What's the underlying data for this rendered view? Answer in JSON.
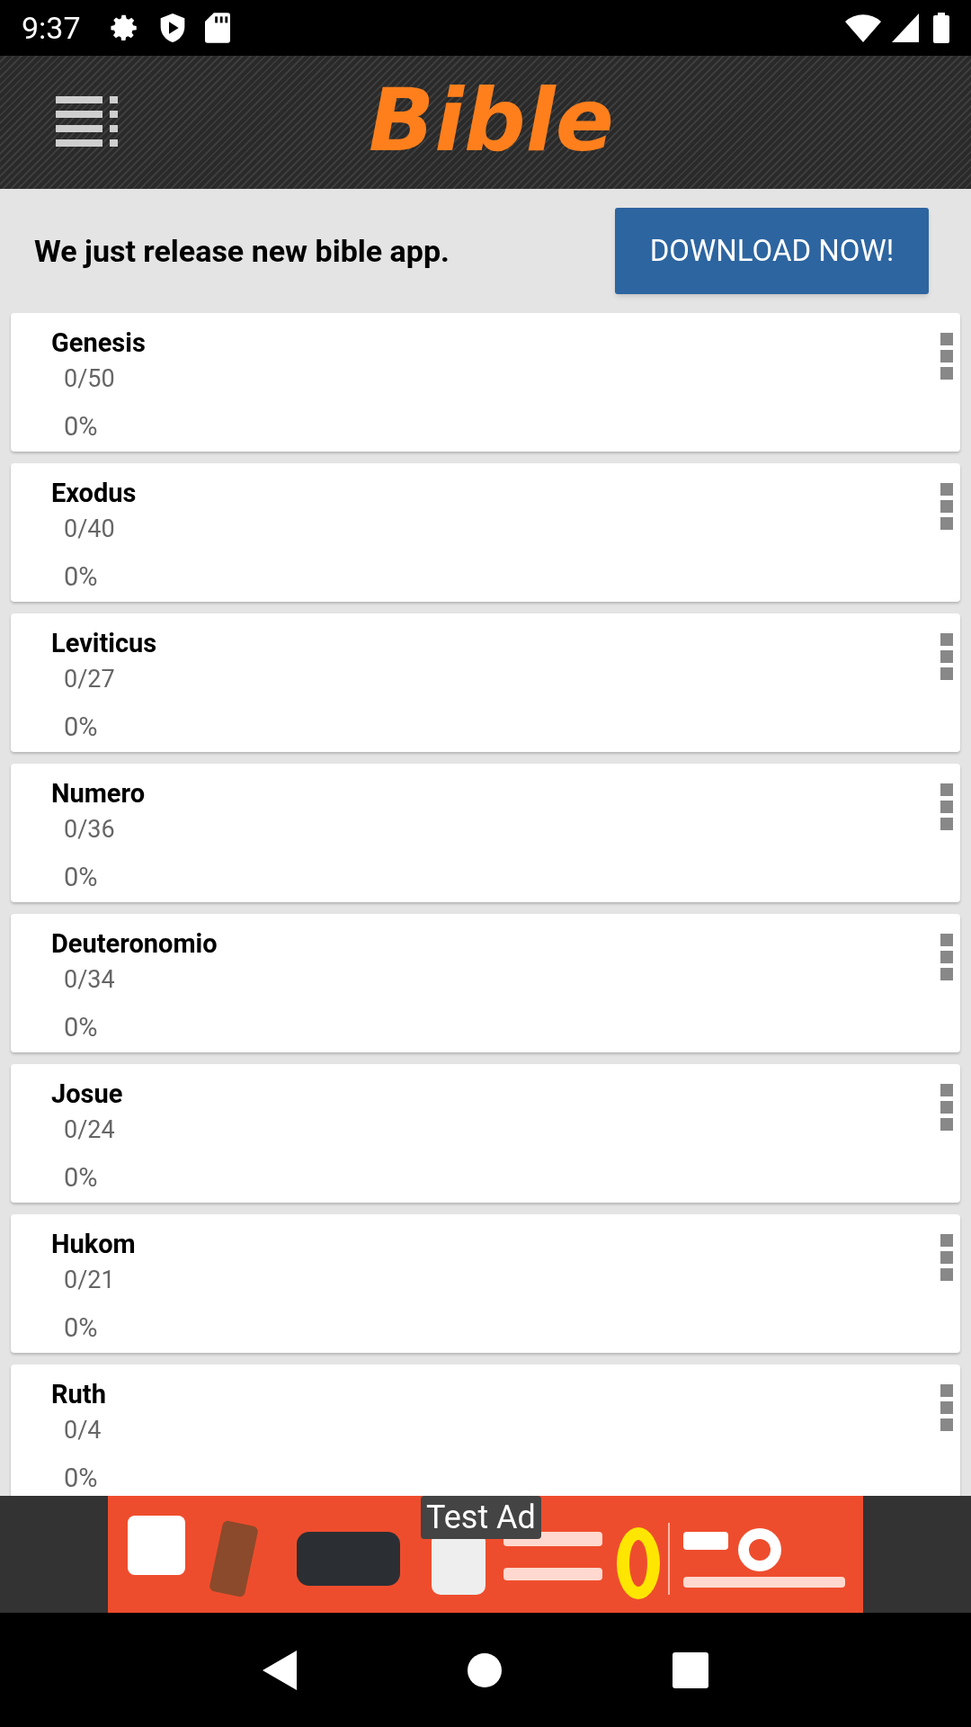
{
  "status_bar": {
    "time": "9:37"
  },
  "header": {
    "title": "Bible"
  },
  "promo": {
    "message": "We just release new bible app.",
    "button": "DOWNLOAD NOW!"
  },
  "books": [
    {
      "name": "Genesis",
      "chapters": "0/50",
      "percent": "0%"
    },
    {
      "name": "Exodus",
      "chapters": "0/40",
      "percent": "0%"
    },
    {
      "name": "Leviticus",
      "chapters": "0/27",
      "percent": "0%"
    },
    {
      "name": "Numero",
      "chapters": "0/36",
      "percent": "0%"
    },
    {
      "name": "Deuteronomio",
      "chapters": "0/34",
      "percent": "0%"
    },
    {
      "name": "Josue",
      "chapters": "0/24",
      "percent": "0%"
    },
    {
      "name": "Hukom",
      "chapters": "0/21",
      "percent": "0%"
    },
    {
      "name": "Ruth",
      "chapters": "0/4",
      "percent": "0%"
    }
  ],
  "ad": {
    "label": "Test Ad"
  }
}
